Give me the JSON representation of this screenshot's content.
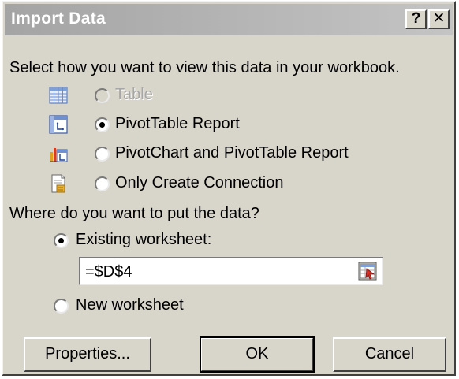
{
  "dialog": {
    "title": "Import Data",
    "help_label": "?",
    "close_label": "✕"
  },
  "view": {
    "prompt": "Select how you want to view this data in your workbook.",
    "options": [
      {
        "label": "Table",
        "icon": "table-icon",
        "selected": false,
        "enabled": false
      },
      {
        "label": "PivotTable Report",
        "icon": "pivottable-icon",
        "selected": true,
        "enabled": true
      },
      {
        "label": "PivotChart and PivotTable Report",
        "icon": "pivotchart-icon",
        "selected": false,
        "enabled": true
      },
      {
        "label": "Only Create Connection",
        "icon": "connection-icon",
        "selected": false,
        "enabled": true
      }
    ]
  },
  "location": {
    "prompt": "Where do you want to put the data?",
    "existing_label": "Existing worksheet:",
    "existing_selected": true,
    "cell_reference": "=$D$4",
    "new_label": "New worksheet",
    "new_selected": false
  },
  "buttons": {
    "properties": "Properties...",
    "ok": "OK",
    "cancel": "Cancel"
  },
  "colors": {
    "dialog_face": "#d8d5cb",
    "title_gradient_start": "#a4a4a4",
    "disabled_text": "#a6a6a6"
  }
}
